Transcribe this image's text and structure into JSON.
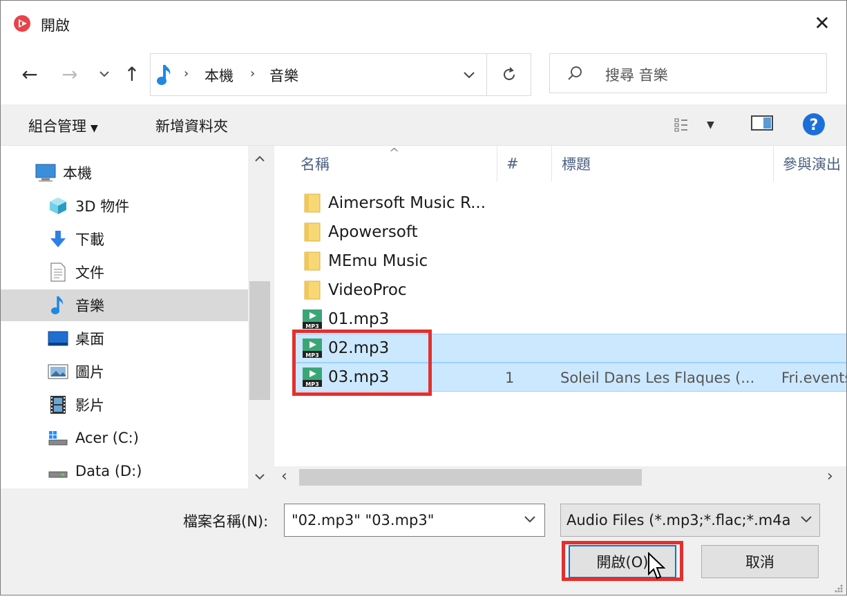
{
  "window": {
    "title": "開啟",
    "close_glyph": "✕"
  },
  "nav_buttons": {
    "back": "←",
    "forward": "→",
    "recent": "⌄",
    "up": "↑"
  },
  "address": {
    "crumbs": [
      "本機",
      "音樂"
    ],
    "separator": "›"
  },
  "search": {
    "placeholder": "搜尋 音樂"
  },
  "toolbar": {
    "organize": "組合管理",
    "new_folder": "新增資料夾",
    "help_glyph": "?"
  },
  "nav_pane": {
    "items": [
      {
        "label": "本機",
        "icon": "computer-icon"
      },
      {
        "label": "3D 物件",
        "icon": "cube-icon"
      },
      {
        "label": "下載",
        "icon": "download-arrow-icon"
      },
      {
        "label": "文件",
        "icon": "document-icon"
      },
      {
        "label": "音樂",
        "icon": "music-note-icon",
        "selected": true
      },
      {
        "label": "桌面",
        "icon": "desktop-icon"
      },
      {
        "label": "圖片",
        "icon": "picture-icon"
      },
      {
        "label": "影片",
        "icon": "film-icon"
      },
      {
        "label": "Acer (C:)",
        "icon": "windows-drive-icon"
      },
      {
        "label": "Data (D:)",
        "icon": "drive-icon"
      }
    ]
  },
  "file_list": {
    "columns": [
      "名稱",
      "#",
      "標題",
      "參與演出"
    ],
    "rows": [
      {
        "name": "Aimersoft Music R...",
        "type": "folder",
        "num": "",
        "title": "",
        "artist": ""
      },
      {
        "name": "Apowersoft",
        "type": "folder",
        "num": "",
        "title": "",
        "artist": ""
      },
      {
        "name": "MEmu Music",
        "type": "folder",
        "num": "",
        "title": "",
        "artist": ""
      },
      {
        "name": "VideoProc",
        "type": "folder",
        "num": "",
        "title": "",
        "artist": ""
      },
      {
        "name": "01.mp3",
        "type": "mp3",
        "num": "",
        "title": "",
        "artist": ""
      },
      {
        "name": "02.mp3",
        "type": "mp3",
        "num": "",
        "title": "",
        "artist": "",
        "selected": true
      },
      {
        "name": "03.mp3",
        "type": "mp3",
        "num": "1",
        "title": "Soleil Dans Les Flaques (...",
        "artist": "Fri.events",
        "selected": true
      }
    ]
  },
  "bottom": {
    "filename_label": "檔案名稱(N):",
    "filename_value": "\"02.mp3\" \"03.mp3\"",
    "filetype_value": "Audio Files (*.mp3;*.flac;*.m4a",
    "open_label": "開啟(O)",
    "cancel_label": "取消"
  },
  "colors": {
    "selection": "#cce8ff",
    "highlight": "#e3302f",
    "accent": "#0078d7",
    "mp3_icon": "#3aa676"
  }
}
